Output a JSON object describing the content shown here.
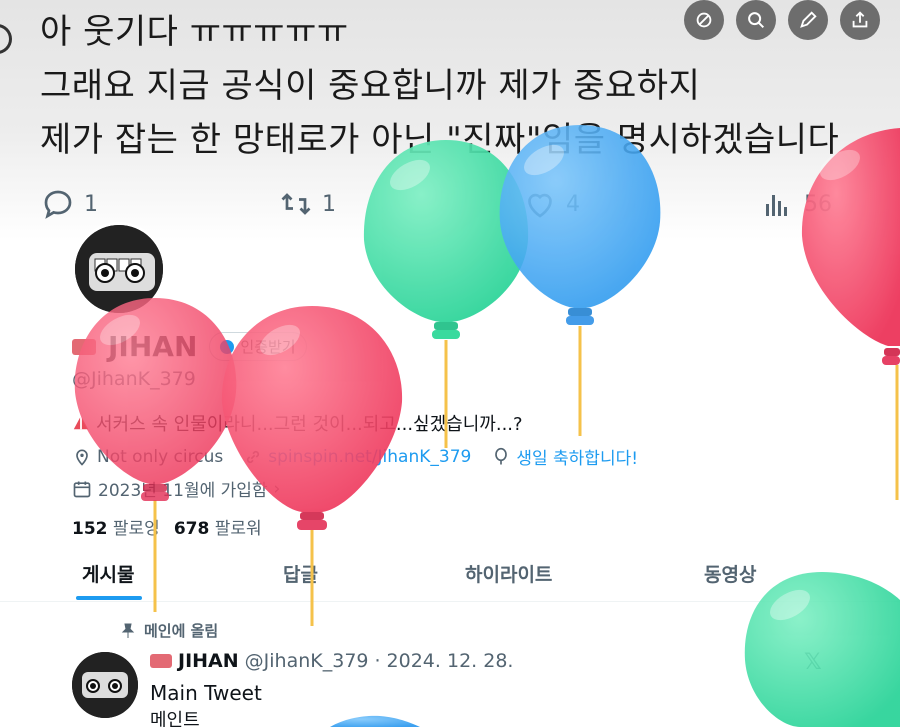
{
  "tweet": {
    "line1": "아 웃기다 ㅠㅠㅠㅠㅠ",
    "line2": "그래요 지금 공식이 중요합니까 제가 중요하지",
    "line3": "제가 잡는 한 망태로가 아닌 \"진짜\"임을 명시하겠습니다",
    "replies": "1",
    "reposts": "1",
    "likes": "4",
    "views": "56"
  },
  "top_actions": [
    "link-off-icon",
    "search-icon",
    "pencil-icon",
    "share-icon"
  ],
  "profile": {
    "name": "JIHAN",
    "verify_label": "인증받기",
    "handle": "@JihanK_379",
    "bio": "서커스 속 인물이라니...그런 것이...되고...싶겠습니까...?",
    "location": "Not only circus",
    "website": "spinspin.net/JihanK_379",
    "birthday": "생일 축하합니다!",
    "joined": "2023년 11월에 가입함",
    "following_count": "152",
    "following_label": "팔로잉",
    "followers_count": "678",
    "followers_label": "팔로워"
  },
  "tabs": [
    "게시물",
    "답글",
    "하이라이트",
    "동영상"
  ],
  "post": {
    "pinned_label": "메인에 올림",
    "name": "JIHAN",
    "handle": "@JihanK_379",
    "date": "2024. 12. 28.",
    "text_line1": "Main Tweet",
    "text_line2": "메인트"
  },
  "colors": {
    "accent": "#1d9bf0",
    "balloon_red": "#f0405f",
    "balloon_green": "#3fe0a3",
    "balloon_blue": "#3ea8f5"
  }
}
